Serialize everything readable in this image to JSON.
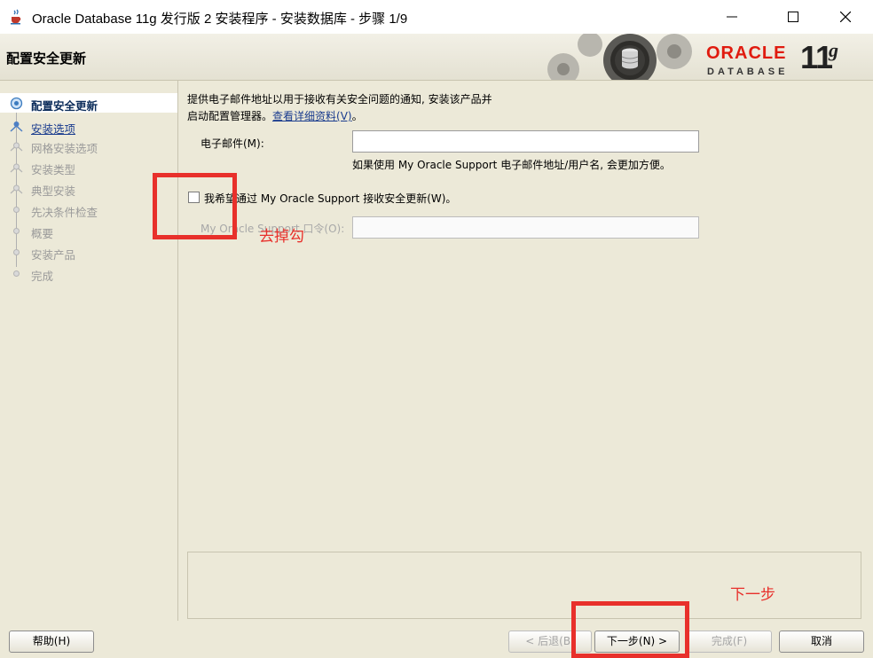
{
  "window": {
    "title": "Oracle Database 11g 发行版 2 安装程序 - 安装数据库 - 步骤 1/9"
  },
  "header": {
    "page_title": "配置安全更新",
    "brand_oracle": "ORACLE",
    "brand_database": "DATABASE",
    "brand_version": "11",
    "brand_version_suffix": "g"
  },
  "sidebar": {
    "steps": [
      {
        "label": "配置安全更新",
        "state": "active"
      },
      {
        "label": "安装选项",
        "state": "link"
      },
      {
        "label": "网格安装选项",
        "state": "disabled"
      },
      {
        "label": "安装类型",
        "state": "disabled"
      },
      {
        "label": "典型安装",
        "state": "disabled"
      },
      {
        "label": "先决条件检查",
        "state": "disabled"
      },
      {
        "label": "概要",
        "state": "disabled"
      },
      {
        "label": "安装产品",
        "state": "disabled"
      },
      {
        "label": "完成",
        "state": "disabled"
      }
    ]
  },
  "main": {
    "intro_line1": "提供电子邮件地址以用于接收有关安全问题的通知, 安装该产品并",
    "intro_line2": "启动配置管理器。",
    "details_link": "查看详细资料(V)",
    "email_label": "电子邮件(M):",
    "email_value": "",
    "email_hint": "如果使用 My Oracle Support 电子邮件地址/用户名, 会更加方便。",
    "security_checkbox_label": "我希望通过 My Oracle Support 接收安全更新(W)。",
    "security_checked": false,
    "password_label": "My Oracle Support 口令(O):",
    "password_value": ""
  },
  "buttons": {
    "help": "帮助(H)",
    "back": "< 后退(B)",
    "next": "下一步(N) >",
    "finish": "完成(F)",
    "cancel": "取消"
  },
  "annotations": {
    "uncheck_note": "去掉勾",
    "next_note": "下一步",
    "color": "#e8302b"
  }
}
